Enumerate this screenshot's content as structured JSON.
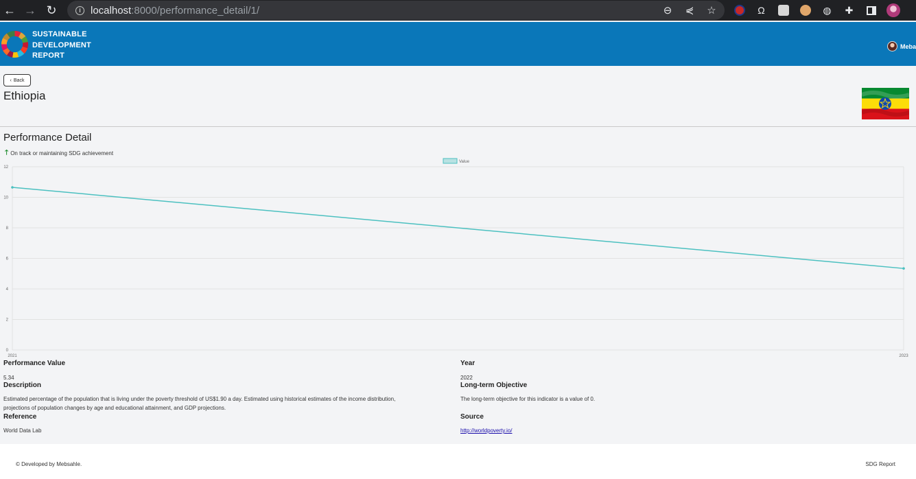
{
  "browser": {
    "url_host": "localhost",
    "url_path": ":8000/performance_detail/1/"
  },
  "header": {
    "brand_line1": "SUSTAINABLE",
    "brand_line2": "DEVELOPMENT",
    "brand_line3": "REPORT",
    "user_name": "Meba"
  },
  "country": {
    "back_label": "Back",
    "name": "Ethiopia"
  },
  "performance": {
    "title": "Performance Detail",
    "status": "On track or maintaining SDG achievement"
  },
  "chart_data": {
    "type": "line",
    "categories": [
      "2021",
      "2023"
    ],
    "series": [
      {
        "name": "Value",
        "values": [
          10.65,
          5.34
        ]
      }
    ],
    "yticks": [
      0,
      2,
      4,
      6,
      8,
      10,
      12
    ],
    "ylim": [
      0,
      12
    ],
    "legend": "top-center",
    "grid": true,
    "color": "#4bc0c0"
  },
  "details": {
    "performance_value_label": "Performance Value",
    "performance_value": "5.34",
    "year_label": "Year",
    "year": "2022",
    "description_label": "Description",
    "description_line1": "Estimated percentage of the population that is living under the poverty threshold of US$1.90 a day. Estimated using historical estimates of the income distribution,",
    "description_line2": "projections of population changes by age and educational attainment, and GDP projections.",
    "objective_label": "Long-term Objective",
    "objective": "The long-term objective for this indicator is a value of 0.",
    "reference_label": "Reference",
    "reference": "World Data Lab",
    "source_label": "Source",
    "source": "http://worldpoverty.io/"
  },
  "footer": {
    "left": "© Developed by Mebsahle.",
    "right": "SDG Report"
  }
}
